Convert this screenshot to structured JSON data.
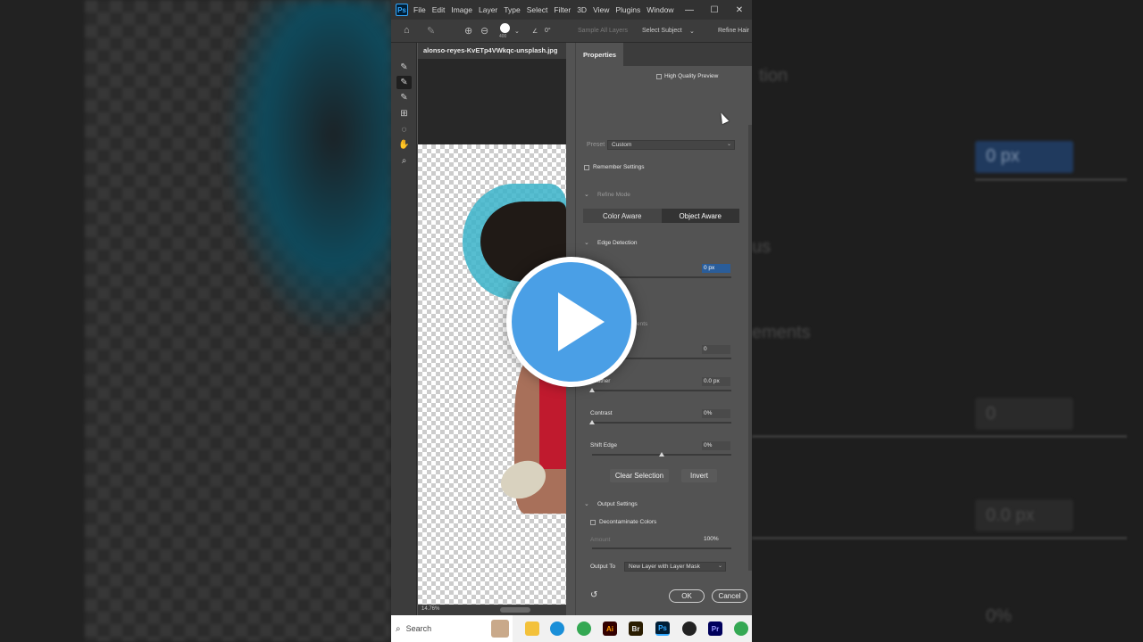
{
  "menubar": {
    "app_logo": "Ps",
    "items": [
      "File",
      "Edit",
      "Image",
      "Layer",
      "Type",
      "Select",
      "Filter",
      "3D",
      "View",
      "Plugins",
      "Window"
    ]
  },
  "window_controls": {
    "minimize": "—",
    "maximize": "☐",
    "close": "✕"
  },
  "options_bar": {
    "brush_size": "400",
    "angle": "0°",
    "sample_all_layers": "Sample All Layers",
    "select_subject": "Select Subject",
    "refine_hair": "Refine Hair"
  },
  "document": {
    "tab_title": "alonso-reyes-KvETp4VWkqc-unsplash.jpg",
    "zoom": "14.76%"
  },
  "properties": {
    "tab": "Properties",
    "high_quality_preview": "High Quality Preview",
    "preset_label": "Preset",
    "preset_value": "Custom",
    "remember_settings": "Remember Settings",
    "refine_mode_title": "Refine Mode",
    "refine_mode_options": [
      "Color Aware",
      "Object Aware"
    ],
    "refine_mode_selected": "Object Aware",
    "edge_detection_title": "Edge Detection",
    "radius_value": "0 px",
    "global_partial": "ents",
    "smooth_value": "0",
    "feather_label": "Feather",
    "feather_value": "0.0 px",
    "contrast_label": "Contrast",
    "contrast_value": "0%",
    "shift_edge_label": "Shift Edge",
    "shift_edge_value": "0%",
    "clear_selection": "Clear Selection",
    "invert": "Invert",
    "output_settings_title": "Output Settings",
    "decontaminate": "Decontaminate Colors",
    "amount_label": "Amount",
    "amount_value": "100%",
    "output_to_label": "Output To",
    "output_to_value": "New Layer with Layer Mask",
    "ok": "OK",
    "cancel": "Cancel"
  },
  "sliders": {
    "feather": 0,
    "contrast": 0,
    "shift_edge": 0.5,
    "amount": 1
  },
  "background_right": {
    "ghost_tion": "tion",
    "ghost_px": "0 px",
    "ghost_us": "us",
    "ghost_ements": "ements",
    "ghost_zero": "0",
    "ghost_px2": "0.0 px",
    "ghost_pct": "0%"
  },
  "taskbar": {
    "search_placeholder": "Search",
    "apps": [
      "Ai",
      "Br",
      "Ps",
      "Pr"
    ]
  },
  "colors": {
    "play_blue": "#4a9fe6",
    "ps_blue": "#31a8ff",
    "selection_blue": "#3ab3c9",
    "dress_red": "#c01a2e"
  }
}
